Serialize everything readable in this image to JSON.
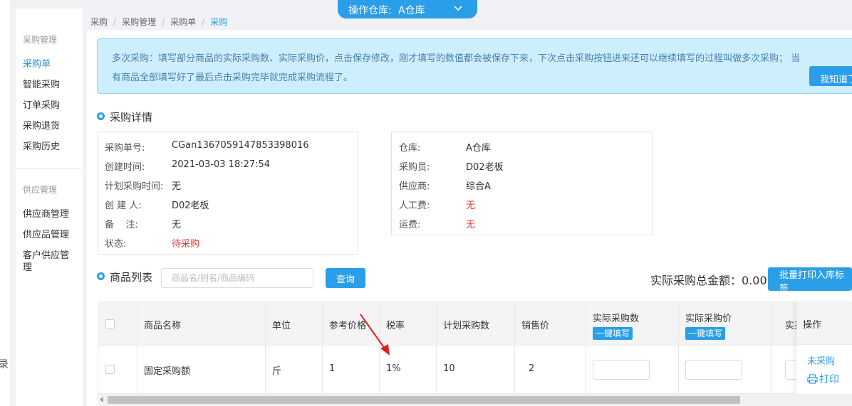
{
  "left_strip": {
    "glyph": "录"
  },
  "sidebar": {
    "groups": [
      {
        "title": "采购管理",
        "items": [
          "采购单",
          "智能采购",
          "订单采购",
          "采购退货",
          "采购历史"
        ]
      },
      {
        "title": "供应管理",
        "items": [
          "供应商管理",
          "供应品管理",
          "客户供应管理"
        ]
      }
    ],
    "active_item": "采购单"
  },
  "warehouse": {
    "label": "操作仓库:",
    "value": "A仓库",
    "icon": "chevron-down-icon"
  },
  "breadcrumb": [
    "采购",
    "采购管理",
    "采购单",
    "采购"
  ],
  "notice": {
    "line1": "多次采购：填写部分商品的实际采购数、实际采购价，点击保存修改，刚才填写的数值都会被保存下来，下次点击采购按钮进来还可以继续填写的过程叫做多次采购；  当",
    "line2": "有商品全部填写好了最后点击采购完毕就完成采购流程了。",
    "button": "我知道了"
  },
  "detail": {
    "title": "采购详情",
    "left": [
      {
        "label": "采购单号:",
        "value": "CGan1367059147853398016"
      },
      {
        "label": "创建时间:",
        "value": "2021-03-03 18:27:54"
      },
      {
        "label": "计划采购时间:",
        "value": "无"
      },
      {
        "label": "创 建 人:",
        "value": "D02老板"
      },
      {
        "label": "备    注:",
        "value": "无"
      },
      {
        "label": "状态:",
        "value": "待采购",
        "red": true
      }
    ],
    "right": [
      {
        "label": "仓库:",
        "value": "A仓库"
      },
      {
        "label": "采购员:",
        "value": "D02老板"
      },
      {
        "label": "供应商:",
        "value": "综合A"
      },
      {
        "label": "人工费:",
        "value": "无",
        "red": true
      },
      {
        "label": "运费:",
        "value": "无",
        "red": true
      }
    ]
  },
  "products": {
    "title": "商品列表",
    "search_placeholder": "商品名/别名/商品编码",
    "search_button": "查询",
    "total_label": "实际采购总金额：0.00",
    "print_tag_button": "批量打印入库标签",
    "columns": [
      "商品名称",
      "单位",
      "参考价格",
      "税率",
      "计划采购数",
      "销售价",
      "实际采购数",
      "实际采购价",
      "实采"
    ],
    "fill_button": "一键填写",
    "rows": [
      {
        "name": "固定采购额",
        "unit": "斤",
        "ref_price": "1",
        "tax": "1%",
        "plan_qty": "10",
        "sale_price": "2"
      }
    ],
    "op_header": "操作",
    "op_status": "未采购",
    "op_print": "打印"
  },
  "colors": {
    "accent": "#2a9ee8",
    "red": "#e23a3a",
    "notice_bg": "#cdeefd"
  }
}
